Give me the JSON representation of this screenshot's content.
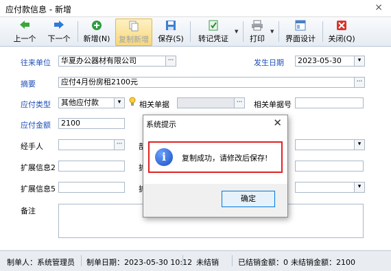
{
  "window": {
    "title": "应付款信息 - 新增",
    "close_glyph": "×"
  },
  "toolbar": {
    "prev": "上一个",
    "next": "下一个",
    "new": "新增(N)",
    "copy_new": "复制新增",
    "save": "保存(S)",
    "post_voucher": "转记凭证",
    "print": "打印",
    "ui_design": "界面设计",
    "close": "关闭(Q)"
  },
  "form": {
    "partner_label": "往来单位",
    "partner_value": "华夏办公器材有限公司",
    "date_label": "发生日期",
    "date_value": "2023-05-30",
    "summary_label": "摘要",
    "summary_value": "应付4月份房租2100元",
    "type_label": "应付类型",
    "type_value": "其他应付款",
    "related_doc_label": "相关单据",
    "related_doc_no_label": "相关单据号",
    "amount_label": "应付金额",
    "amount_value": "2100",
    "handler_label": "经手人",
    "ext2_label": "扩展信息2",
    "ext5_label": "扩展信息5",
    "note_label": "备注",
    "ellipsis": "···",
    "dropdown": "▾",
    "partial_labels": [
      "部",
      "扩",
      "扩"
    ]
  },
  "dialog": {
    "title": "系统提示",
    "close_glyph": "✕",
    "icon_glyph": "i",
    "message": "复制成功，请修改后保存!",
    "ok_label": "确定"
  },
  "status": {
    "creator": "制单人：系统管理员",
    "created_date": "制单日期：2023-05-30 10:12",
    "settle_status": "未结销",
    "settled_amount": "已结销金额：0",
    "unsettled_amount": "未结销金额：2100"
  },
  "colors": {
    "label_blue": "#1f4fb8",
    "highlight_red": "#e02020",
    "toolbar_active": "#f8d77a"
  }
}
